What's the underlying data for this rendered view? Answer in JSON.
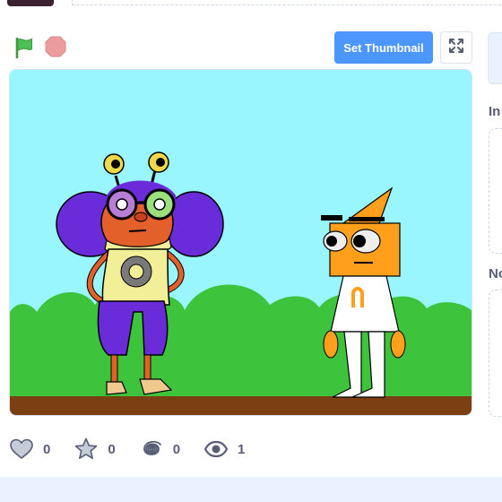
{
  "toolbar": {
    "set_thumbnail_label": "Set Thumbnail",
    "green_flag_icon": "green-flag-icon",
    "stop_icon": "stop-icon",
    "fullscreen_icon": "fullscreen-icon"
  },
  "sidebar": {
    "instructions_label": "In",
    "notes_label": "No"
  },
  "stats": {
    "loves": "0",
    "favorites": "0",
    "remixes": "0",
    "views": "1"
  },
  "colors": {
    "accent": "#4c97ff",
    "flag": "#4cbf56",
    "stop": "#ec9c9c",
    "stage_sky": "#99f6ff",
    "grass": "#3ec33c",
    "ground": "#7b3f12"
  }
}
